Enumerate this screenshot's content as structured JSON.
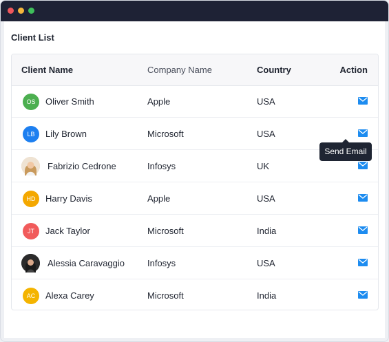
{
  "page_title": "Client List",
  "columns": {
    "client": "Client Name",
    "company": "Company Name",
    "country": "Country",
    "action": "Action"
  },
  "rows": [
    {
      "name": "Oliver Smith",
      "initials": "OS",
      "avatar_color": "#4caf50",
      "company": "Apple",
      "country": "USA"
    },
    {
      "name": "Lily Brown",
      "initials": "LB",
      "avatar_color": "#1d7ff0",
      "company": "Microsoft",
      "country": "USA"
    },
    {
      "name": "Fabrizio Cedrone",
      "initials": "",
      "avatar_color": "#d9b98e",
      "company": "Infosys",
      "country": "UK"
    },
    {
      "name": "Harry Davis",
      "initials": "HD",
      "avatar_color": "#f4a800",
      "company": "Apple",
      "country": "USA"
    },
    {
      "name": "Jack Taylor",
      "initials": "JT",
      "avatar_color": "#f15b5b",
      "company": "Microsoft",
      "country": "India"
    },
    {
      "name": "Alessia Caravaggio",
      "initials": "",
      "avatar_color": "#3a3a3a",
      "company": "Infosys",
      "country": "USA"
    },
    {
      "name": "Alexa Carey",
      "initials": "AC",
      "avatar_color": "#f4b400",
      "company": "Microsoft",
      "country": "India"
    }
  ],
  "tooltip": "Send Email",
  "colors": {
    "titlebar": "#1e2235",
    "accent": "#1d8cf0"
  },
  "icons": {
    "action": "mail-icon"
  }
}
